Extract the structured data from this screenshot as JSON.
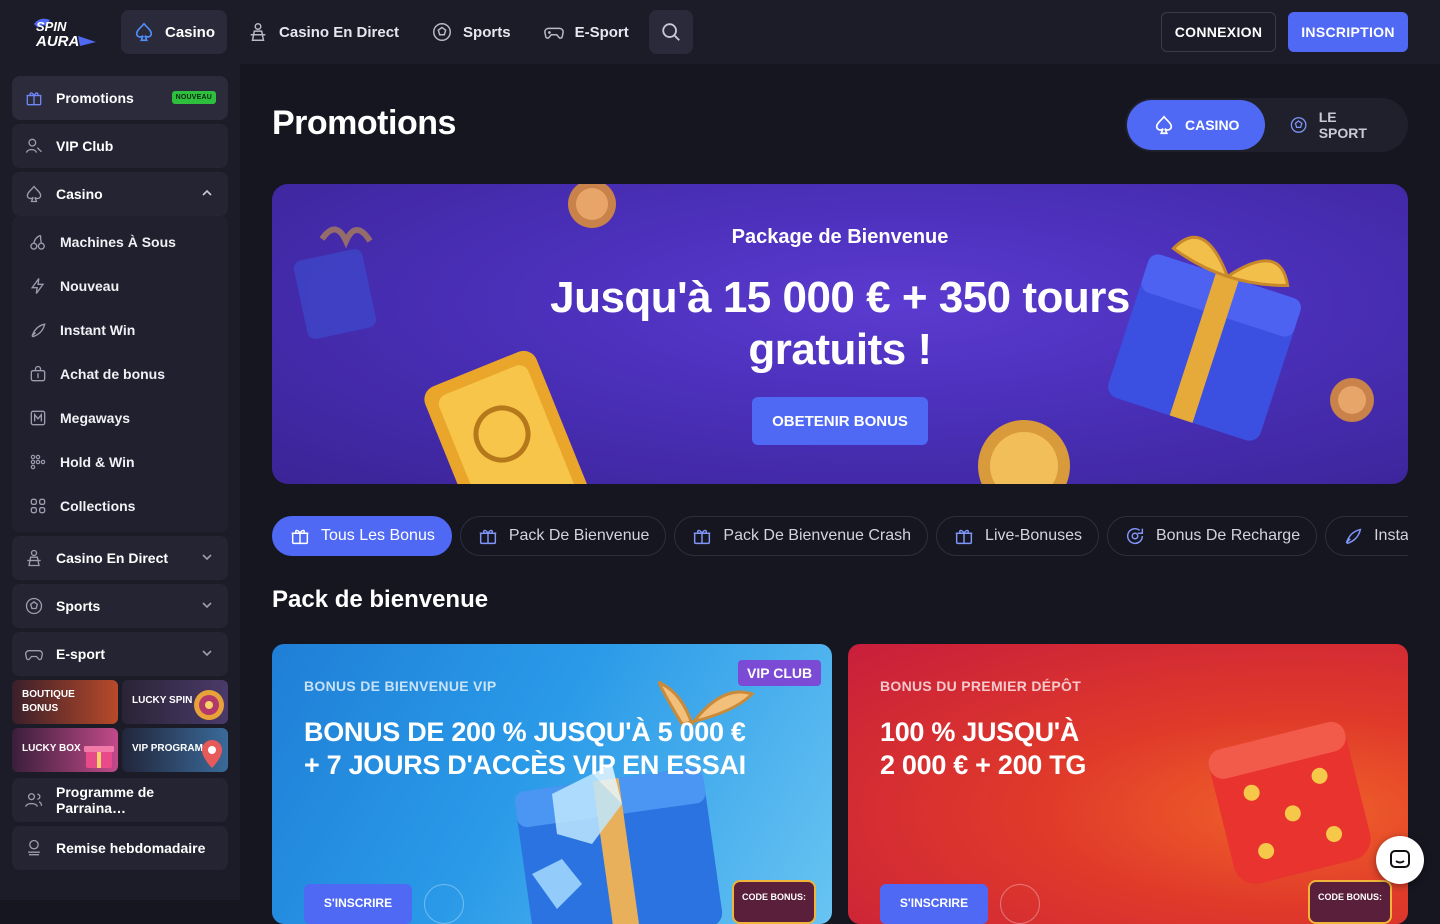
{
  "brand": {
    "logo_text": "SPIN AURA",
    "accent": "#4f69f5"
  },
  "topnav": {
    "items": [
      {
        "label": "Casino",
        "icon": "spade-icon",
        "active": true
      },
      {
        "label": "Casino En Direct",
        "icon": "dealer-icon",
        "active": false
      },
      {
        "label": "Sports",
        "icon": "soccer-ball-icon",
        "active": false
      },
      {
        "label": "E-Sport",
        "icon": "gamepad-icon",
        "active": false
      }
    ],
    "login": "CONNEXION",
    "signup": "INSCRIPTION"
  },
  "sidebar": {
    "promotions": "Promotions",
    "new_badge": "NOUVEAU",
    "vip": "VIP Club",
    "casino": "Casino",
    "casino_sub": [
      "Machines À Sous",
      "Nouveau",
      "Instant Win",
      "Achat de bonus",
      "Megaways",
      "Hold & Win",
      "Collections"
    ],
    "live": "Casino En Direct",
    "sports": "Sports",
    "esport": "E-sport",
    "tiles": [
      "BOUTIQUE BONUS",
      "LUCKY SPIN",
      "LUCKY BOX",
      "VIP PROGRAM"
    ],
    "referral": "Programme de Parraina…",
    "weekly": "Remise hebdomadaire"
  },
  "main": {
    "title": "Promotions",
    "switch": {
      "casino": "CASINO",
      "sport": "LE SPORT"
    },
    "hero": {
      "subtitle": "Package de Bienvenue",
      "title_line1": "Jusqu'à 15 000 € + 350 tours",
      "title_line2": "gratuits !",
      "button": "OBETENIR BONUS"
    },
    "chips": [
      "Tous Les Bonus",
      "Pack De Bienvenue",
      "Pack De Bienvenue Crash",
      "Live-Bonuses",
      "Bonus De Recharge",
      "Instant"
    ],
    "section_title": "Pack de bienvenue",
    "cards": [
      {
        "label": "BONUS DE BIENVENUE VIP",
        "title_line1": "BONUS DE 200 % JUSQU'À 5 000 €",
        "title_line2": "+ 7 JOURS D'ACCÈS VIP EN ESSAI",
        "badge": "VIP CLUB",
        "button": "S'INSCRIRE",
        "code": "CODE BONUS:"
      },
      {
        "label": "BONUS DU PREMIER DÉPÔT",
        "title_line1": "100 % JUSQU'À",
        "title_line2": "2 000 € + 200 TG",
        "button": "S'INSCRIRE",
        "code": "CODE BONUS:"
      }
    ]
  }
}
